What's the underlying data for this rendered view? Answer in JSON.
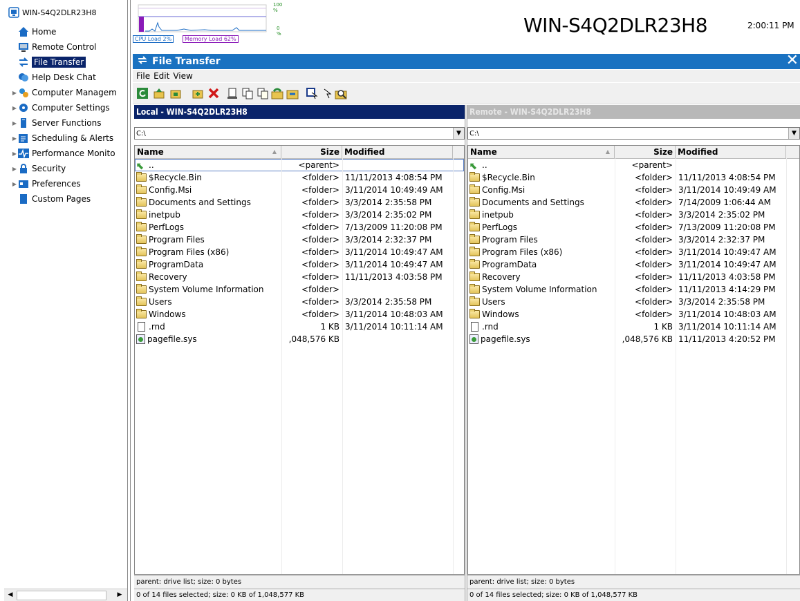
{
  "sidebar": {
    "machine": "WIN-S4Q2DLR23H8",
    "items": [
      {
        "label": "Home",
        "icon": "home-icon"
      },
      {
        "label": "Remote Control",
        "icon": "monitor-icon"
      },
      {
        "label": "File Transfer",
        "icon": "file-transfer-icon",
        "selected": true
      },
      {
        "label": "Help Desk Chat",
        "icon": "chat-icon"
      },
      {
        "label": "Computer Managem",
        "icon": "gears-icon",
        "expandable": true
      },
      {
        "label": "Computer Settings",
        "icon": "settings-icon",
        "expandable": true
      },
      {
        "label": "Server Functions",
        "icon": "server-icon",
        "expandable": true
      },
      {
        "label": "Scheduling & Alerts",
        "icon": "schedule-icon",
        "expandable": true
      },
      {
        "label": "Performance Monito",
        "icon": "performance-icon",
        "expandable": true
      },
      {
        "label": "Security",
        "icon": "lock-icon",
        "expandable": true
      },
      {
        "label": "Preferences",
        "icon": "preferences-icon",
        "expandable": true
      },
      {
        "label": "Custom Pages",
        "icon": "page-icon"
      }
    ]
  },
  "performance": {
    "max_label": "100 %",
    "min_label": "0 %",
    "cpu_label": "CPU Load 2%",
    "memory_label": "Memory Load 62%",
    "cpu_percent": 2,
    "memory_percent": 62,
    "cpu_color": "#1a6bc4",
    "memory_color": "#8a1ab8"
  },
  "header": {
    "hostname": "WIN-S4Q2DLR23H8",
    "time": "2:00:11 PM"
  },
  "file_transfer": {
    "title": "File Transfer",
    "accent_color": "#1a72c1",
    "menu": [
      "File",
      "Edit",
      "View"
    ],
    "toolbar_icons": [
      "refresh-icon",
      "up-folder-icon",
      "home-folder-icon",
      "new-folder-icon",
      "delete-icon",
      "rename-icon",
      "copy-icon",
      "copy-to-icon",
      "transfer-icon",
      "move-icon",
      "select-icon",
      "select-all-icon",
      "find-icon"
    ],
    "columns": {
      "name": "Name",
      "size": "Size",
      "modified": "Modified"
    },
    "local": {
      "title": "Local - WIN-S4Q2DLR23H8",
      "path": "C:\\",
      "rows": [
        {
          "type": "parent",
          "name": "..",
          "size": "<parent>",
          "modified": ""
        },
        {
          "type": "folder",
          "name": "$Recycle.Bin",
          "size": "<folder>",
          "modified": "11/11/2013 4:08:54 PM"
        },
        {
          "type": "folder",
          "name": "Config.Msi",
          "size": "<folder>",
          "modified": "3/11/2014 10:49:49 AM"
        },
        {
          "type": "folder",
          "name": "Documents and Settings",
          "size": "<folder>",
          "modified": "3/3/2014 2:35:58 PM"
        },
        {
          "type": "folder",
          "name": "inetpub",
          "size": "<folder>",
          "modified": "3/3/2014 2:35:02 PM"
        },
        {
          "type": "folder",
          "name": "PerfLogs",
          "size": "<folder>",
          "modified": "7/13/2009 11:20:08 PM"
        },
        {
          "type": "folder",
          "name": "Program Files",
          "size": "<folder>",
          "modified": "3/3/2014 2:32:37 PM"
        },
        {
          "type": "folder",
          "name": "Program Files (x86)",
          "size": "<folder>",
          "modified": "3/11/2014 10:49:47 AM"
        },
        {
          "type": "folder",
          "name": "ProgramData",
          "size": "<folder>",
          "modified": "3/11/2014 10:49:47 AM"
        },
        {
          "type": "folder",
          "name": "Recovery",
          "size": "<folder>",
          "modified": "11/11/2013 4:03:58 PM"
        },
        {
          "type": "folder",
          "name": "System Volume Information",
          "size": "<folder>",
          "modified": ""
        },
        {
          "type": "folder",
          "name": "Users",
          "size": "<folder>",
          "modified": "3/3/2014 2:35:58 PM"
        },
        {
          "type": "folder",
          "name": "Windows",
          "size": "<folder>",
          "modified": "3/11/2014 10:48:03 AM"
        },
        {
          "type": "doc",
          "name": ".rnd",
          "size": "1 KB",
          "modified": "3/11/2014 10:11:14 AM"
        },
        {
          "type": "sys",
          "name": "pagefile.sys",
          "size": ",048,576 KB",
          "modified": ""
        }
      ],
      "status": "parent: drive list; size: 0 bytes",
      "selection": "0 of 14 files selected; size: 0 KB of 1,048,577 KB"
    },
    "remote": {
      "title": "Remote - WIN-S4Q2DLR23H8",
      "path": "C:\\",
      "rows": [
        {
          "type": "parent",
          "name": "..",
          "size": "<parent>",
          "modified": ""
        },
        {
          "type": "folder",
          "name": "$Recycle.Bin",
          "size": "<folder>",
          "modified": "11/11/2013 4:08:54 PM"
        },
        {
          "type": "folder",
          "name": "Config.Msi",
          "size": "<folder>",
          "modified": "3/11/2014 10:49:49 AM"
        },
        {
          "type": "folder",
          "name": "Documents and Settings",
          "size": "<folder>",
          "modified": "7/14/2009 1:06:44 AM"
        },
        {
          "type": "folder",
          "name": "inetpub",
          "size": "<folder>",
          "modified": "3/3/2014 2:35:02 PM"
        },
        {
          "type": "folder",
          "name": "PerfLogs",
          "size": "<folder>",
          "modified": "7/13/2009 11:20:08 PM"
        },
        {
          "type": "folder",
          "name": "Program Files",
          "size": "<folder>",
          "modified": "3/3/2014 2:32:37 PM"
        },
        {
          "type": "folder",
          "name": "Program Files (x86)",
          "size": "<folder>",
          "modified": "3/11/2014 10:49:47 AM"
        },
        {
          "type": "folder",
          "name": "ProgramData",
          "size": "<folder>",
          "modified": "3/11/2014 10:49:47 AM"
        },
        {
          "type": "folder",
          "name": "Recovery",
          "size": "<folder>",
          "modified": "11/11/2013 4:03:58 PM"
        },
        {
          "type": "folder",
          "name": "System Volume Information",
          "size": "<folder>",
          "modified": "11/11/2013 4:14:29 PM"
        },
        {
          "type": "folder",
          "name": "Users",
          "size": "<folder>",
          "modified": "3/3/2014 2:35:58 PM"
        },
        {
          "type": "folder",
          "name": "Windows",
          "size": "<folder>",
          "modified": "3/11/2014 10:48:03 AM"
        },
        {
          "type": "doc",
          "name": ".rnd",
          "size": "1 KB",
          "modified": "3/11/2014 10:11:14 AM"
        },
        {
          "type": "sys",
          "name": "pagefile.sys",
          "size": ",048,576 KB",
          "modified": "11/11/2013 4:20:52 PM"
        }
      ],
      "status": "parent: drive list; size: 0 bytes",
      "selection": "0 of 14 files selected; size: 0 KB of 1,048,577 KB"
    }
  }
}
